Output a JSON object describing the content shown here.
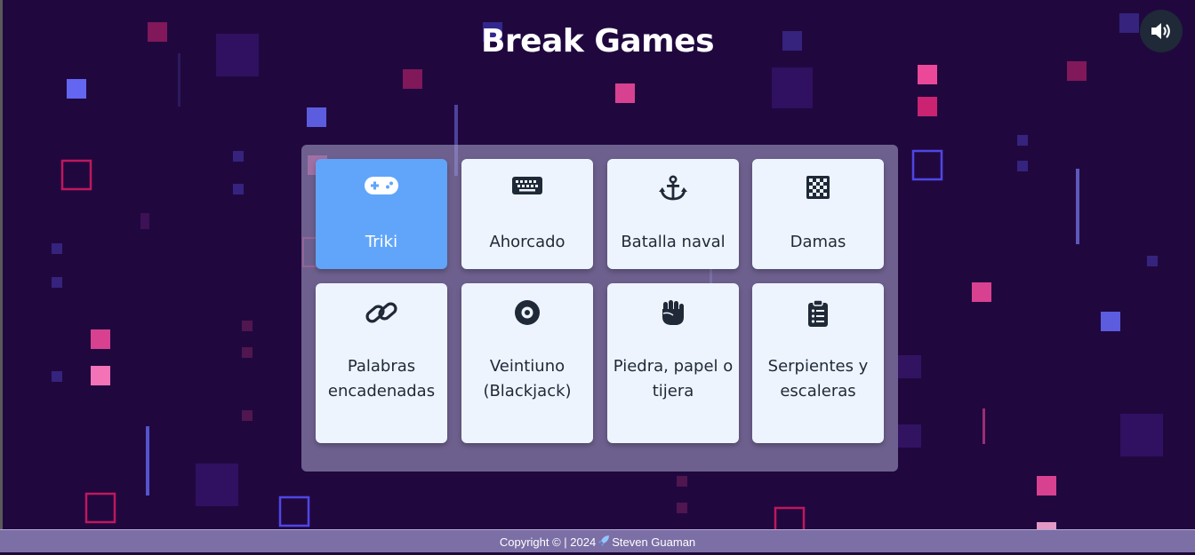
{
  "header": {
    "title": "Break Games"
  },
  "sound": {
    "icon": "volume-icon"
  },
  "games": [
    {
      "label": "Triki",
      "icon": "gamepad-icon",
      "active": true
    },
    {
      "label": "Ahorcado",
      "icon": "keyboard-icon",
      "active": false
    },
    {
      "label": "Batalla naval",
      "icon": "anchor-icon",
      "active": false
    },
    {
      "label": "Damas",
      "icon": "checkerboard-icon",
      "active": false
    },
    {
      "label": "Palabras encadenadas",
      "icon": "link-icon",
      "active": false
    },
    {
      "label": "Veintiuno (Blackjack)",
      "icon": "record-icon",
      "active": false
    },
    {
      "label": "Piedra, papel o tijera",
      "icon": "fist-icon",
      "active": false
    },
    {
      "label": "Serpientes y escaleras",
      "icon": "clipboard-list-icon",
      "active": false
    }
  ],
  "footer": {
    "copyright": "Copyright © | 2024",
    "author": "Steven Guaman",
    "icon": "rocket-icon"
  },
  "colors": {
    "background": "#20083f",
    "active_card": "#60a5fa",
    "card": "#eef4fd",
    "panel": "#a6a0c8",
    "square_pink": "#ec4899",
    "square_blue": "#6366f1"
  }
}
